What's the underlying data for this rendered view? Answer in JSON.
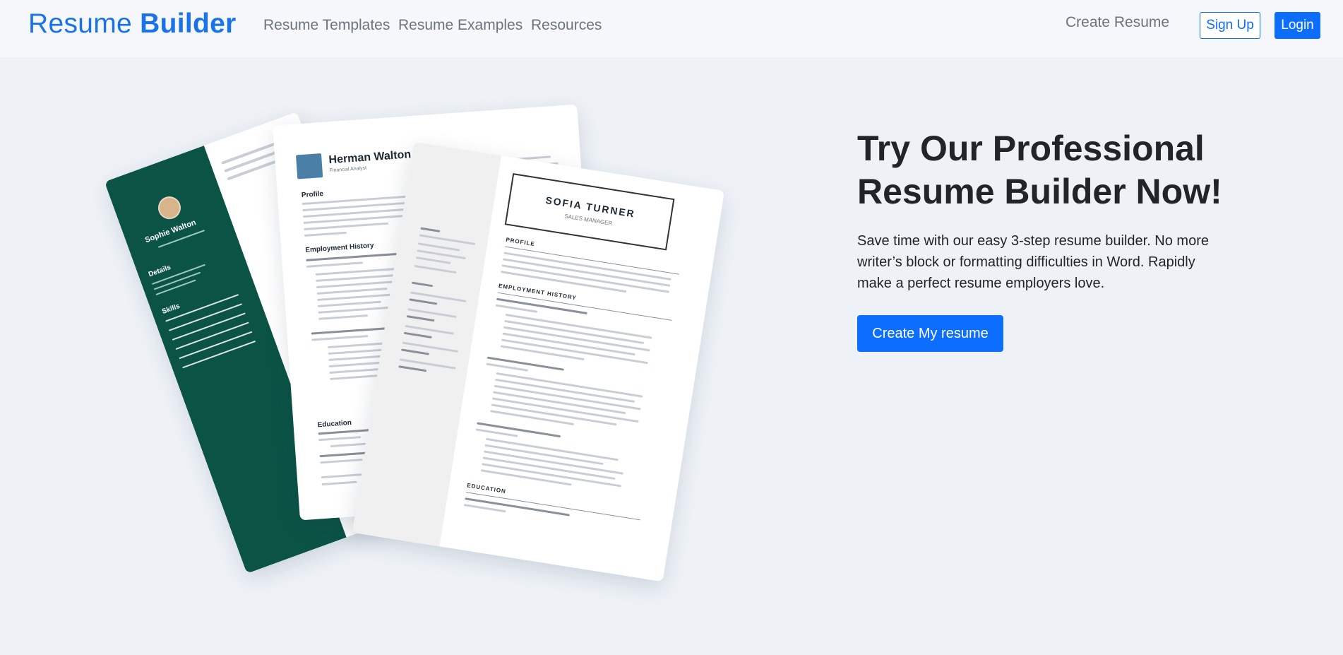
{
  "nav": {
    "brand_part1": "Resume",
    "brand_part2": "Builder",
    "links": [
      "Resume Templates",
      "Resume Examples",
      "Resources"
    ],
    "create": "Create Resume",
    "signup": "Sign Up",
    "login": "Login"
  },
  "hero": {
    "title": "Try Our Professional Resume Builder Now!",
    "description": "Save time with our easy 3-step resume builder. No more writer’s block or formatting difficulties in Word. Rapidly make a perfect resume employers love.",
    "cta": "Create My resume"
  },
  "resumes": {
    "green": {
      "name": "Sophie Walton",
      "details": "Details",
      "skills": "Skills"
    },
    "mid": {
      "name": "Herman Walton",
      "title": "Financial Analyst",
      "profile": "Profile",
      "employment": "Employment History",
      "education": "Education"
    },
    "front": {
      "name": "SOFIA TURNER",
      "title": "SALES MANAGER",
      "profile": "PROFILE",
      "employment": "EMPLOYMENT HISTORY",
      "education": "EDUCATION"
    }
  },
  "colors": {
    "primary": "#0d6efd",
    "brand": "#1a73e8",
    "dark_green": "#0b5345",
    "text": "#212529",
    "muted": "#6c757d",
    "page_bg": "#eef2f7",
    "nav_bg": "#f5f7fa"
  }
}
